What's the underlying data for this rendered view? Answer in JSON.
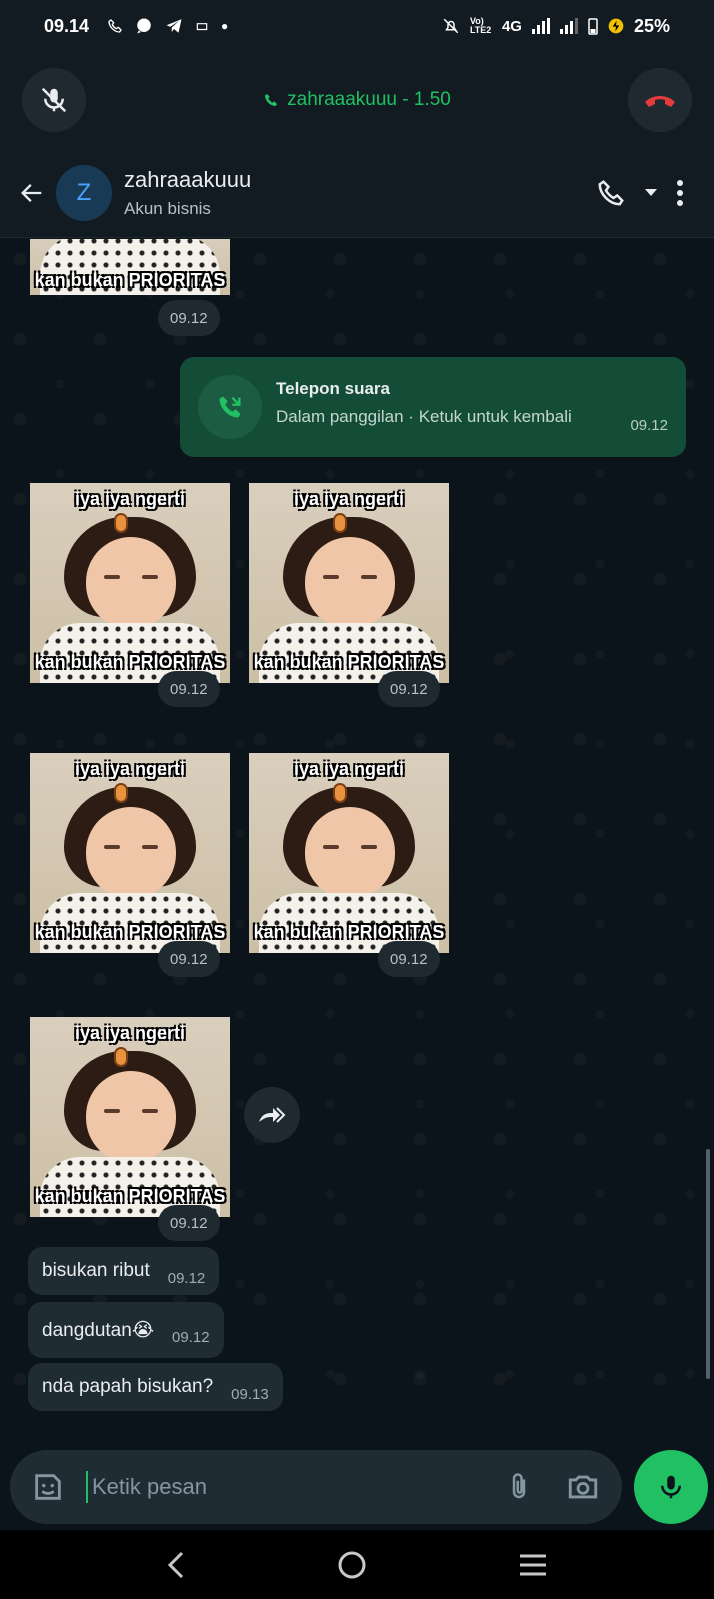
{
  "status_bar": {
    "time": "09.14",
    "network": "4G",
    "lte_label": "Vo) LTE2",
    "battery": "25%"
  },
  "call_bar": {
    "title": "zahraaakuuu - 1.50"
  },
  "header": {
    "avatar_letter": "Z",
    "name": "zahraaakuuu",
    "subtitle": "Akun bisnis"
  },
  "chat": {
    "top_sticker_caption": "kan bukan PRIORITAS",
    "top_sticker_time": "09.12",
    "call_message": {
      "title": "Telepon suara",
      "subtitle": "Dalam panggilan · Ketuk untuk kembali",
      "time": "09.12"
    },
    "stickers": [
      {
        "top": "iya iya ngerti",
        "bottom": "kan bukan PRIORITAS",
        "time": "09.12"
      },
      {
        "top": "iya iya ngerti",
        "bottom": "kan bukan PRIORITAS",
        "time": "09.12"
      },
      {
        "top": "iya iya ngerti",
        "bottom": "kan bukan PRIORITAS",
        "time": "09.12"
      },
      {
        "top": "iya iya ngerti",
        "bottom": "kan bukan PRIORITAS",
        "time": "09.12"
      },
      {
        "top": "iya iya ngerti",
        "bottom": "kan bukan PRIORITAS",
        "time": "09.12"
      }
    ],
    "messages": [
      {
        "text": "bisukan ribut",
        "time": "09.12"
      },
      {
        "text": "dangdutan😭",
        "time": "09.12"
      },
      {
        "text": "nda papah bisukan?",
        "time": "09.13"
      }
    ]
  },
  "input": {
    "placeholder": "Ketik pesan"
  },
  "colors": {
    "accent": "#21c063",
    "hangup": "#e53b3b",
    "outgoing_bubble": "#144d37",
    "incoming_bubble": "#1f2c34",
    "background": "#0b141a"
  }
}
